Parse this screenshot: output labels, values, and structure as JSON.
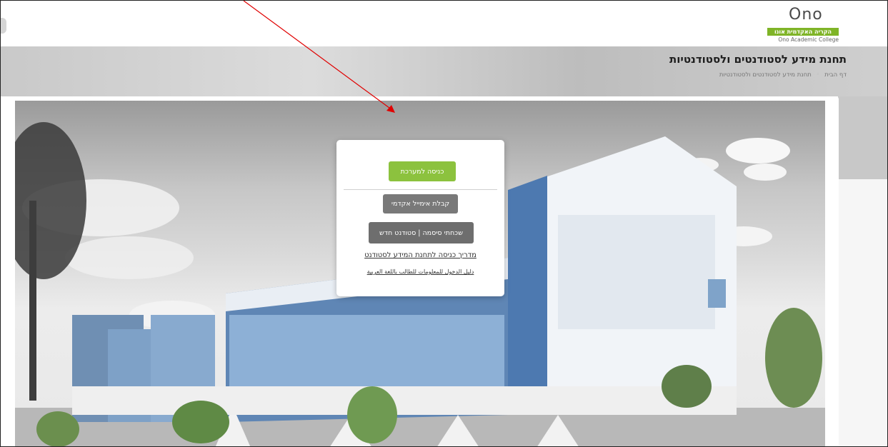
{
  "header": {
    "logo_mark": "Ono",
    "logo_hebrew": "הקריה האקדמית אונו",
    "logo_english": "Ono Academic College"
  },
  "banner": {
    "title": "תחנת מידע לסטודנטים ולסטודנטיות",
    "breadcrumb_home": "דף הבית",
    "breadcrumb_current": "תחנת מידע לסטודנטים ולסטודנטיות"
  },
  "card": {
    "login_label": "כניסה למערכת",
    "email_label": "קבלת אימייל אקדמי",
    "forgot_label": "שכחתי סיסמה | סטודנט חדש",
    "guide_link": "מדריך כניסה לתחנת המידע לסטודנט",
    "arabic_link": "دليل الدخول للمعلومات للطالب باللغة العربية"
  },
  "colors": {
    "accent_green": "#8cc23e",
    "button_grey": "#797979",
    "annotation_red": "#e00000"
  }
}
